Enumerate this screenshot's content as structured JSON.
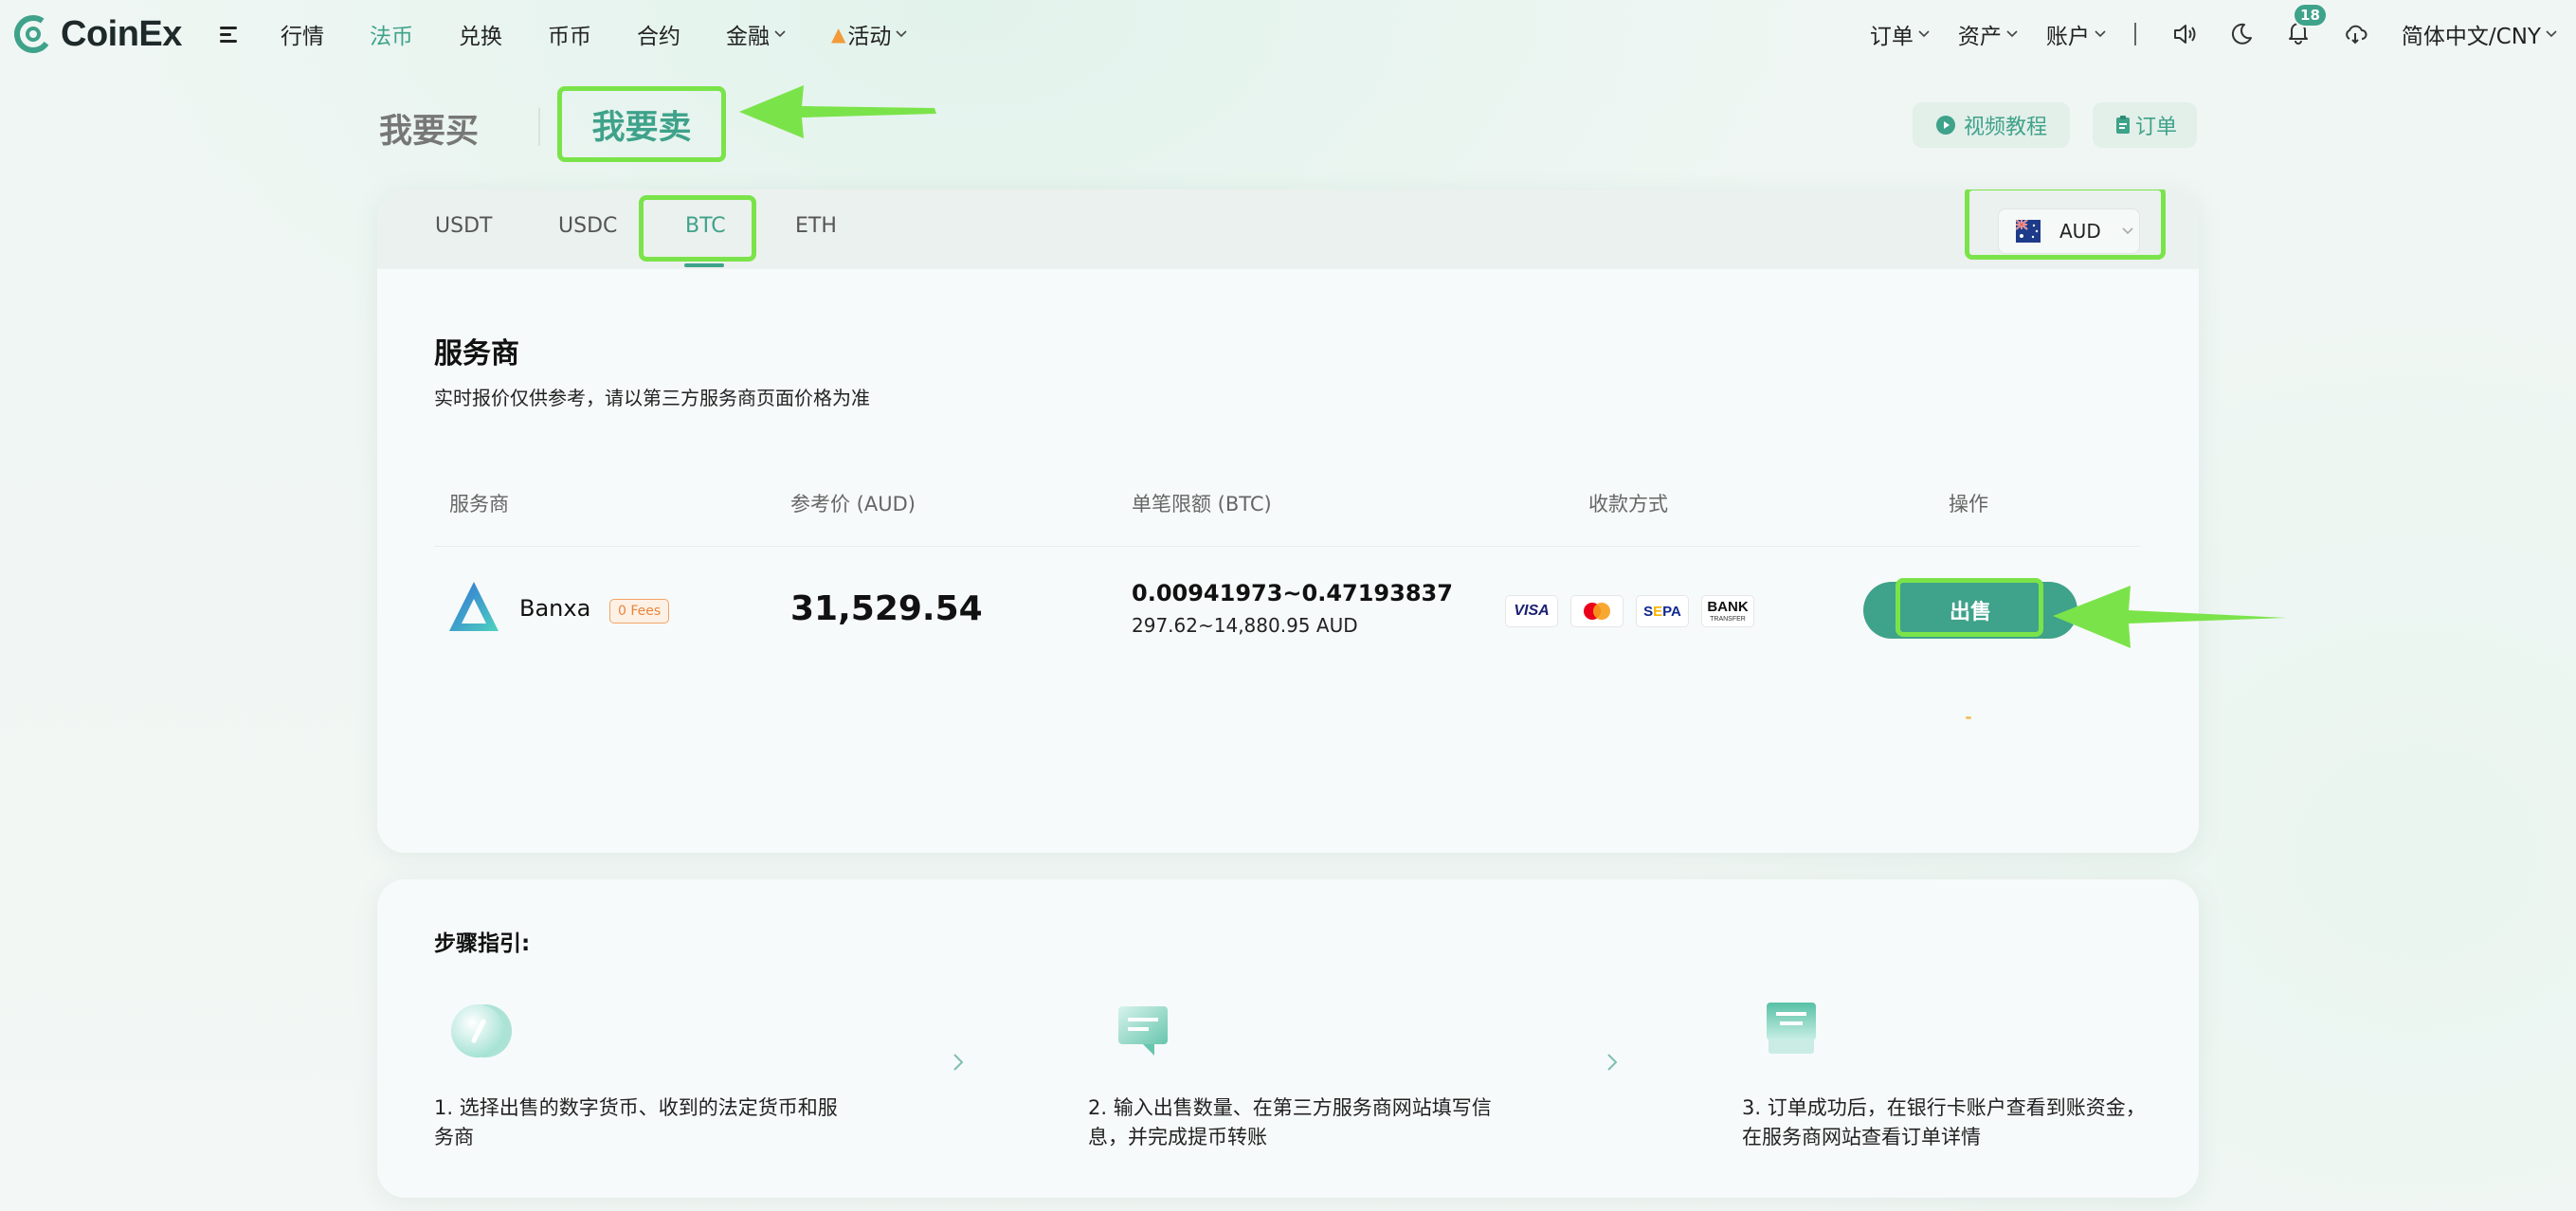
{
  "brand": {
    "name": "CoinEx",
    "accent": "#3fa28a",
    "highlight": "#7be34a"
  },
  "nav": {
    "items": [
      {
        "label": "行情",
        "active": false
      },
      {
        "label": "法币",
        "active": true
      },
      {
        "label": "兑换",
        "active": false
      },
      {
        "label": "币币",
        "active": false
      },
      {
        "label": "合约",
        "active": false
      },
      {
        "label": "金融",
        "active": false,
        "dropdown": true
      },
      {
        "label": "活动",
        "active": false,
        "dropdown": true,
        "icon": "fire-icon"
      }
    ],
    "right": {
      "orders": "订单",
      "assets": "资产",
      "account": "账户",
      "notification_count": "18",
      "language": "简体中文/CNY"
    }
  },
  "trade_mode": {
    "buy": "我要买",
    "sell": "我要卖",
    "active": "sell"
  },
  "header_actions": {
    "video": "视频教程",
    "orders": "订单"
  },
  "coins": {
    "items": [
      "USDT",
      "USDC",
      "BTC",
      "ETH"
    ],
    "active": "BTC"
  },
  "currency": {
    "selected": "AUD",
    "flag": "australia-flag-icon"
  },
  "providers": {
    "title": "服务商",
    "subtitle": "实时报价仅供参考，请以第三方服务商页面价格为准",
    "columns": [
      "服务商",
      "参考价 (AUD)",
      "单笔限额 (BTC)",
      "收款方式",
      "操作"
    ],
    "rows": [
      {
        "name": "Banxa",
        "badge": "0 Fees",
        "price": "31,529.54",
        "limit": "0.00941973~0.47193837",
        "limit_fiat": "297.62~14,880.95 AUD",
        "payments": [
          "VISA",
          "mastercard",
          "SEPA",
          "BANK TRANSFER"
        ],
        "action": "出售"
      }
    ]
  },
  "payment_labels": {
    "visa": "VISA",
    "sepa_s": "S",
    "sepa_rest": "PA",
    "sepa_e": "E",
    "bank": "BANK",
    "transfer": "TRANSFER"
  },
  "steps": {
    "title": "步骤指引:",
    "items": [
      {
        "text": "1. 选择出售的数字货币、收到的法定货币和服务商"
      },
      {
        "text": "2. 输入出售数量、在第三方服务商网站填写信息，并完成提币转账"
      },
      {
        "text": "3. 订单成功后，在银行卡账户查看到账资金，在服务商网站查看订单详情"
      }
    ]
  }
}
